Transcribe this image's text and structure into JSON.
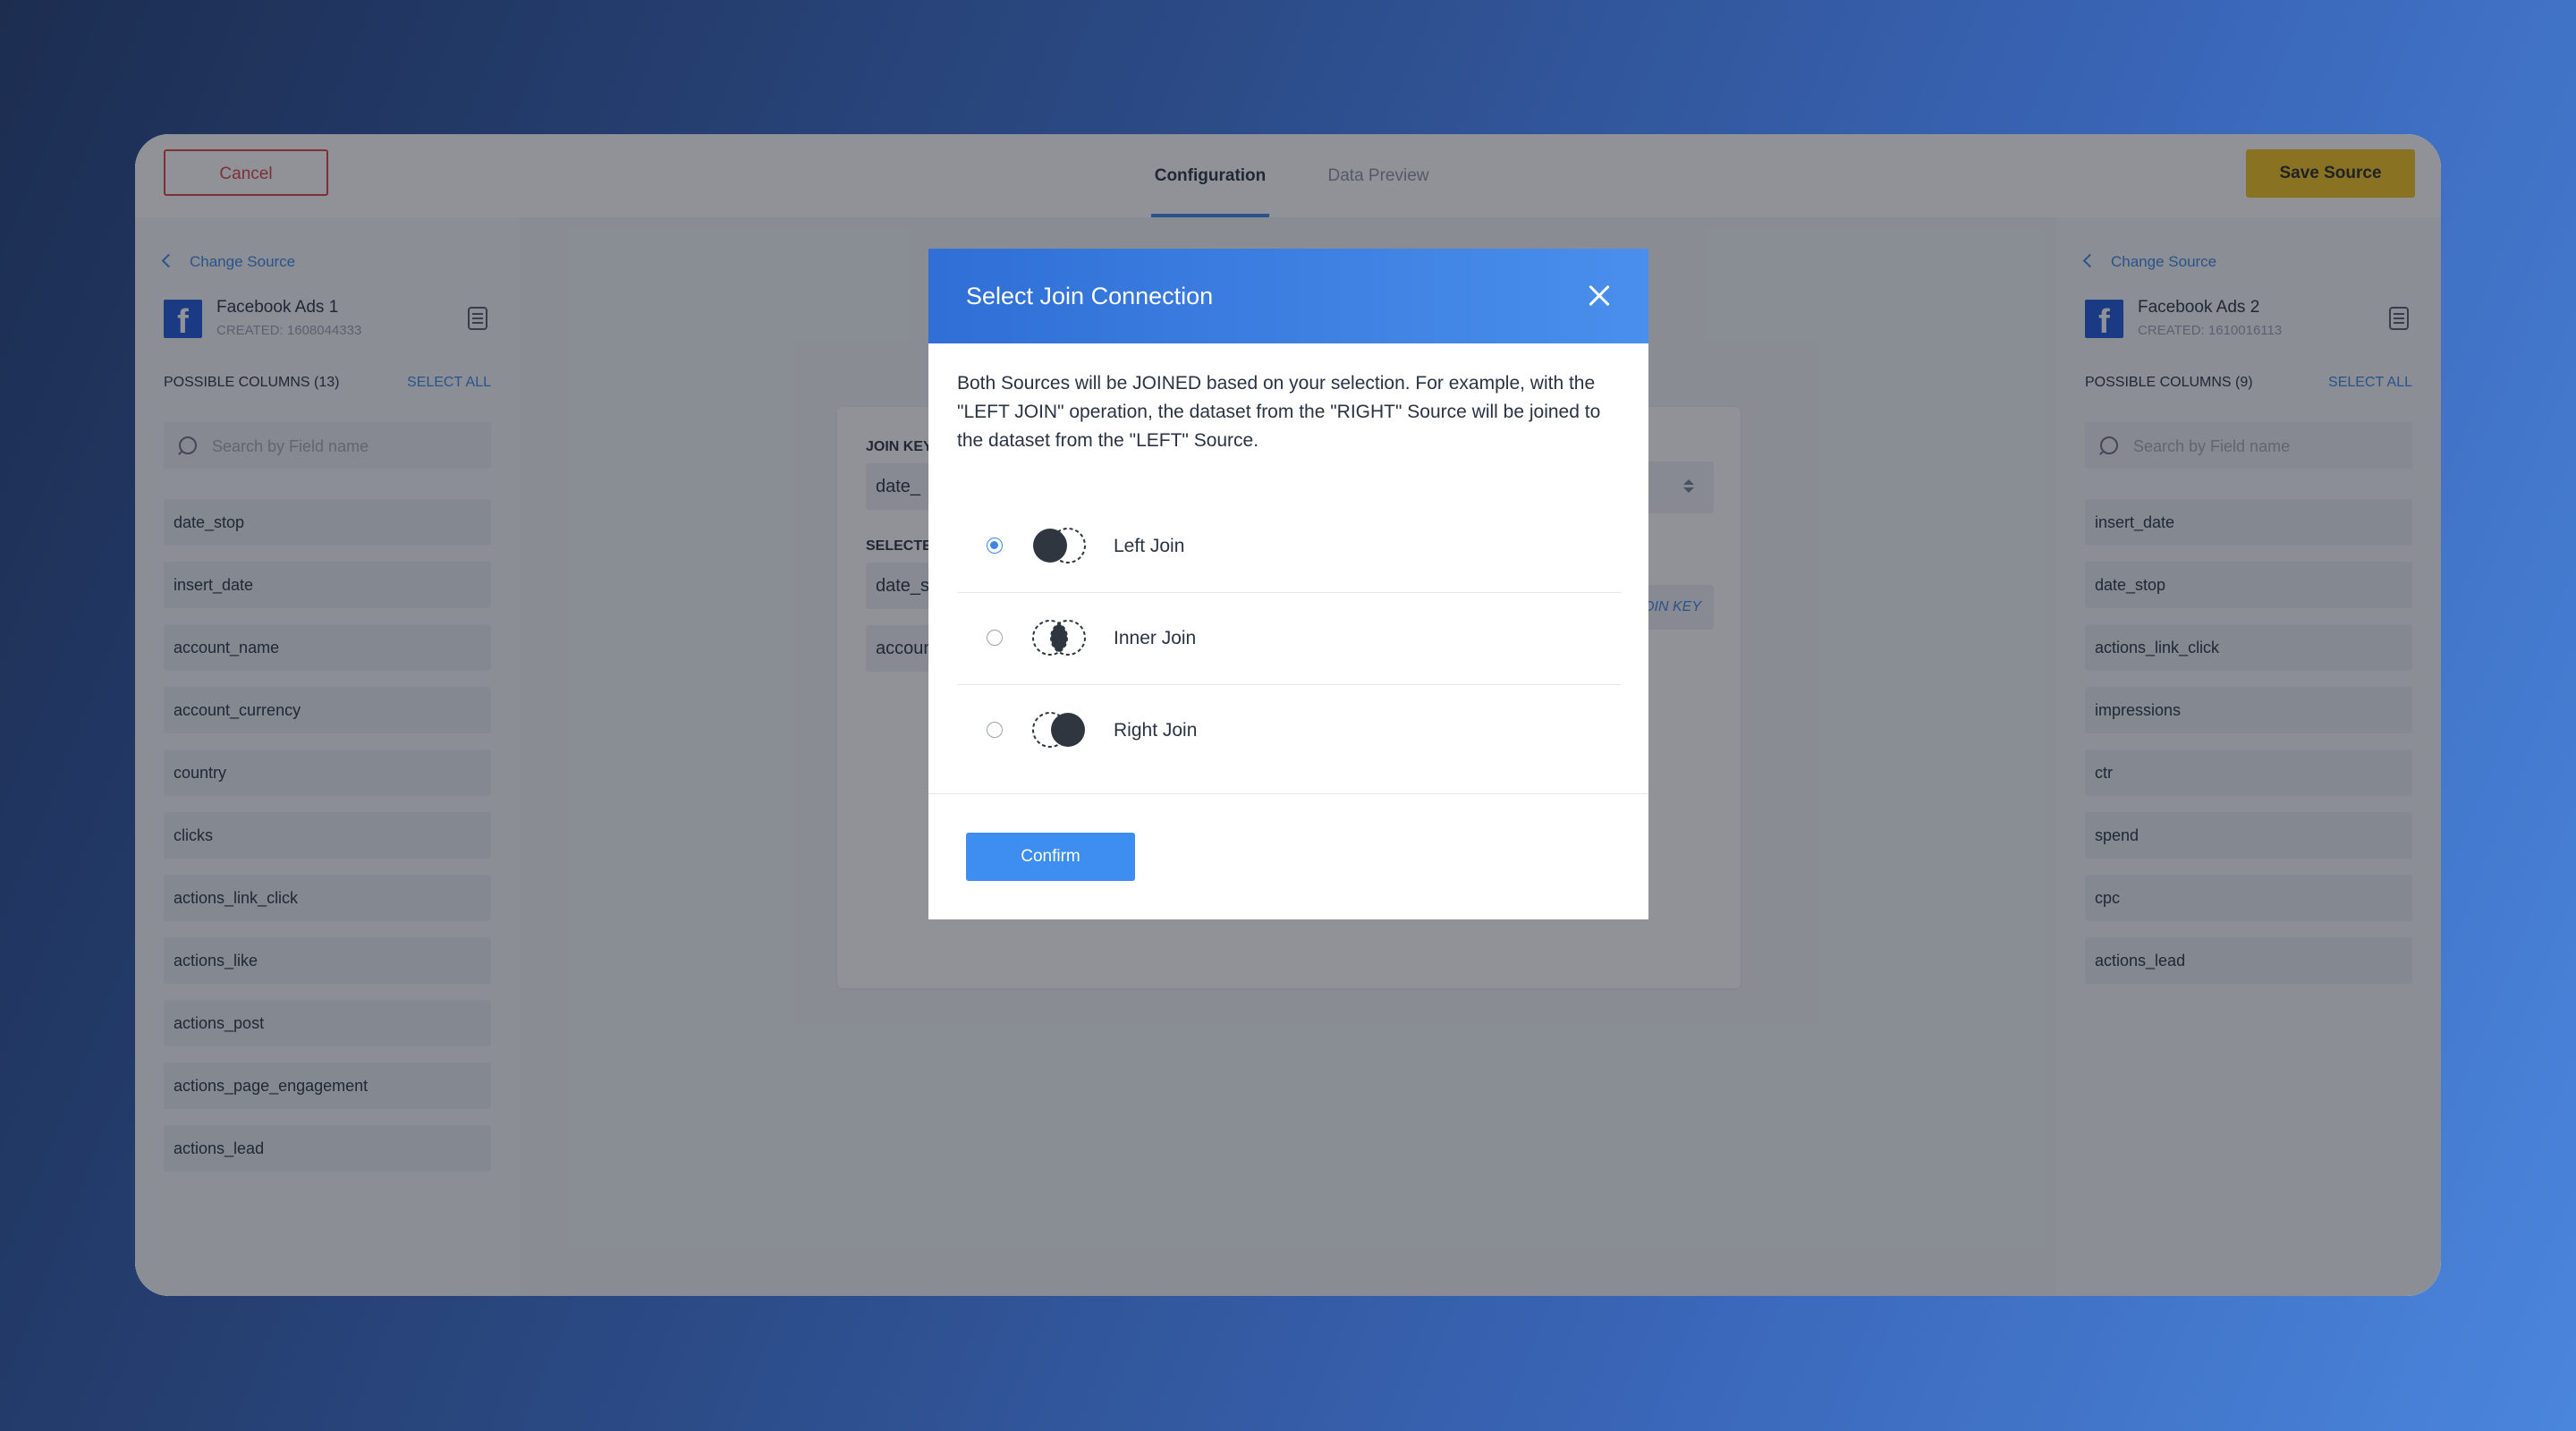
{
  "topbar": {
    "cancel_label": "Cancel",
    "tabs": [
      {
        "label": "Configuration",
        "active": true
      },
      {
        "label": "Data Preview",
        "active": false
      }
    ],
    "save_label": "Save Source"
  },
  "left_source": {
    "change_label": "Change Source",
    "name": "Facebook Ads 1",
    "created": "CREATED: 1608044333",
    "logo_letter": "f",
    "columns_label": "POSSIBLE COLUMNS (13)",
    "select_all": "SELECT ALL",
    "search_placeholder": "Search by Field name",
    "columns": [
      "date_stop",
      "insert_date",
      "account_name",
      "account_currency",
      "country",
      "clicks",
      "actions_link_click",
      "actions_like",
      "actions_post",
      "actions_page_engagement",
      "actions_lead"
    ]
  },
  "right_source": {
    "change_label": "Change Source",
    "name": "Facebook Ads 2",
    "created": "CREATED: 1610016113",
    "logo_letter": "f",
    "columns_label": "POSSIBLE COLUMNS (9)",
    "select_all": "SELECT ALL",
    "search_placeholder": "Search by Field name",
    "columns": [
      "insert_date",
      "date_stop",
      "actions_link_click",
      "impressions",
      "ctr",
      "spend",
      "cpc",
      "actions_lead"
    ]
  },
  "config_card": {
    "join_key_label": "JOIN KEY",
    "join_key_value": "date_",
    "selected_label": "SELECTE",
    "selected_values": [
      "date_st",
      "accoun"
    ],
    "join_key_button": "OIN KEY"
  },
  "modal": {
    "title": "Select Join Connection",
    "description": "Both Sources will be JOINED based on your selection. For example, with the \"LEFT JOIN\" operation, the dataset from the \"RIGHT\" Source will be joined to the dataset from the \"LEFT\" Source.",
    "options": [
      {
        "label": "Left Join",
        "selected": true,
        "icon": "left-join-icon"
      },
      {
        "label": "Inner Join",
        "selected": false,
        "icon": "inner-join-icon"
      },
      {
        "label": "Right Join",
        "selected": false,
        "icon": "right-join-icon"
      }
    ],
    "confirm_label": "Confirm"
  },
  "colors": {
    "accent": "#3d85e6",
    "save": "#f2c21b",
    "cancel": "#d94545"
  }
}
